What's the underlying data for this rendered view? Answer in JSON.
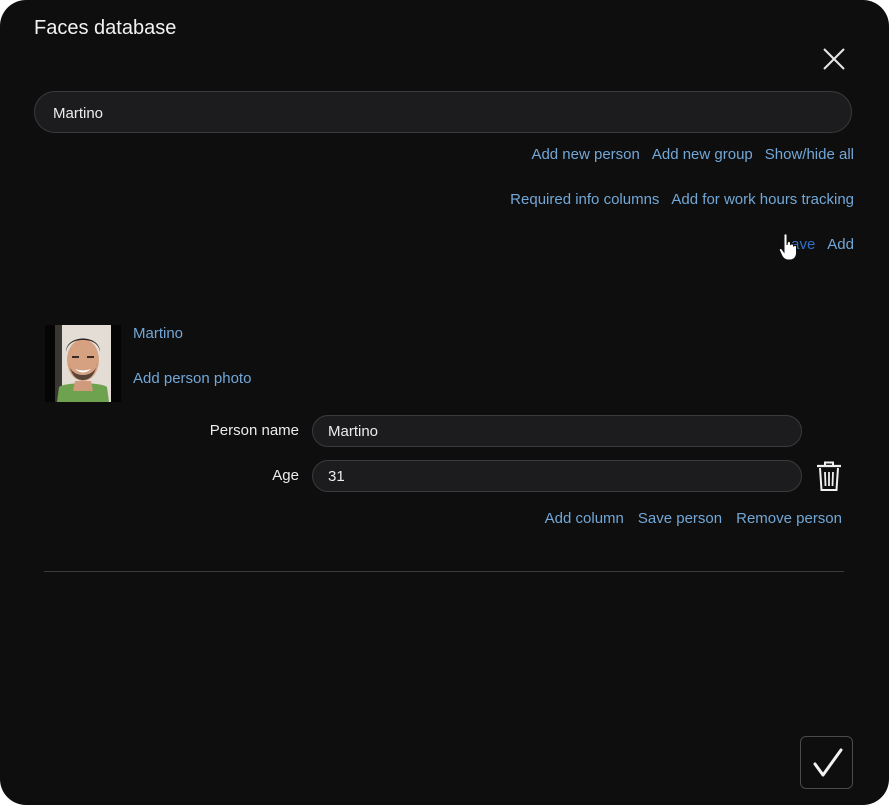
{
  "dialog": {
    "title": "Faces database",
    "close_icon": "close-icon"
  },
  "search": {
    "value": "Martino"
  },
  "toolbar": {
    "row1": [
      "Add new person",
      "Add new group",
      "Show/hide all"
    ],
    "row2": [
      "Required info columns",
      "Add for work hours tracking"
    ],
    "row3": [
      "ave",
      "Add"
    ]
  },
  "person": {
    "name_link": "Martino",
    "add_photo": "Add person photo",
    "fields": {
      "name_label": "Person name",
      "name_value": "Martino",
      "age_label": "Age",
      "age_value": "31"
    },
    "actions": {
      "add_column": "Add column",
      "save_person": "Save person",
      "remove_person": "Remove person"
    }
  },
  "colors": {
    "background": "#0e0e0f",
    "link": "#72a7d6",
    "input_bg": "#1c1c1e",
    "border": "#3a3a3e"
  },
  "icons": [
    "close-icon",
    "trash-icon",
    "checkmark-icon",
    "hand-cursor-icon"
  ]
}
